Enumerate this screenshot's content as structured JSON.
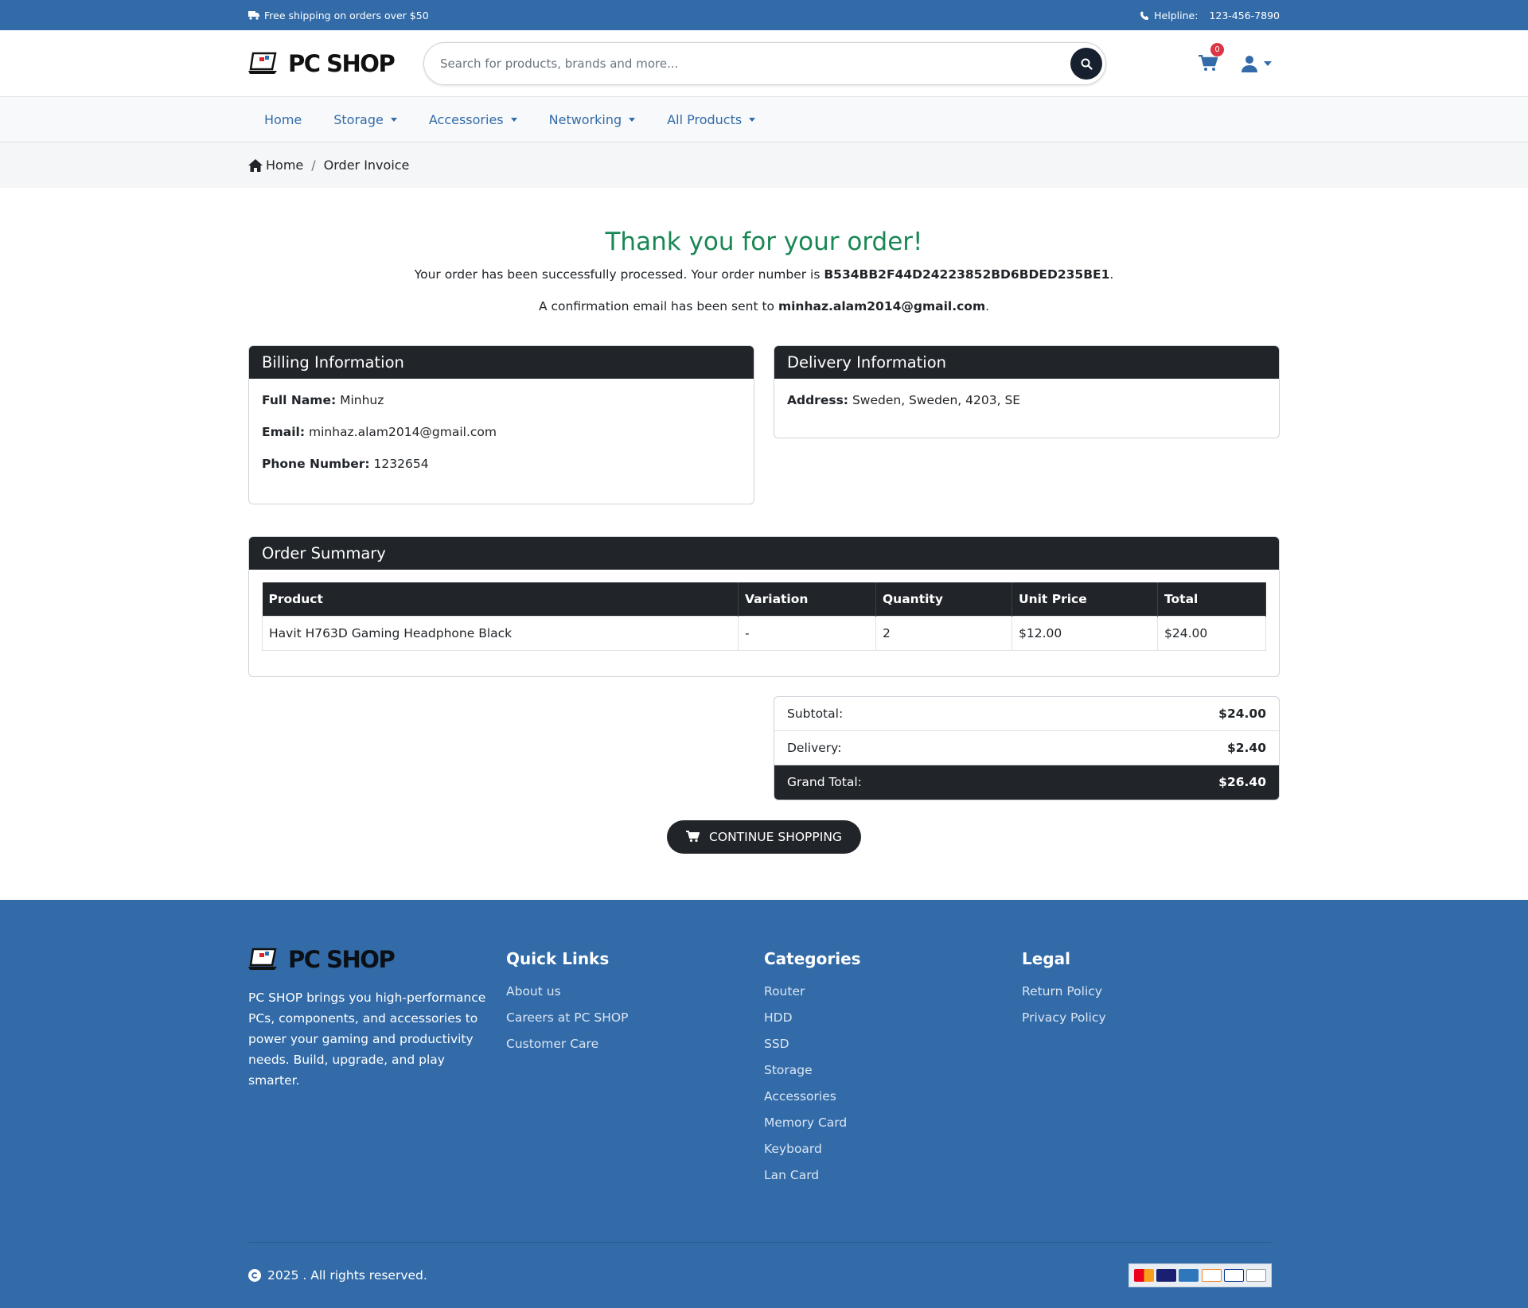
{
  "topbar": {
    "shipping_text": "Free shipping on orders over $50",
    "helpline_label": "Helpline:",
    "helpline_number": "123-456-7890"
  },
  "header": {
    "logo_text": "PC SHOP",
    "search_placeholder": "Search for products, brands and more...",
    "cart_count": "0"
  },
  "nav": {
    "items": [
      {
        "label": "Home",
        "dropdown": false
      },
      {
        "label": "Storage",
        "dropdown": true
      },
      {
        "label": "Accessories",
        "dropdown": true
      },
      {
        "label": "Networking",
        "dropdown": true
      },
      {
        "label": "All Products",
        "dropdown": true
      }
    ]
  },
  "breadcrumb": {
    "home": "Home",
    "separator": "/",
    "current": "Order Invoice"
  },
  "confirmation": {
    "title": "Thank you for your order!",
    "order_prefix": "Your order has been successfully processed. Your order number is ",
    "order_number": "B534BB2F44D24223852BD6BDED235BE1",
    "email_prefix": "A confirmation email has been sent to ",
    "email": "minhaz.alam2014@gmail.com",
    "period": "."
  },
  "billing": {
    "title": "Billing Information",
    "full_name_label": "Full Name:",
    "full_name": "Minhuz",
    "email_label": "Email:",
    "email": "minhaz.alam2014@gmail.com",
    "phone_label": "Phone Number:",
    "phone": "1232654"
  },
  "delivery": {
    "title": "Delivery Information",
    "address_label": "Address:",
    "address": "Sweden, Sweden, 4203, SE"
  },
  "order_summary": {
    "title": "Order Summary",
    "columns": [
      "Product",
      "Variation",
      "Quantity",
      "Unit Price",
      "Total"
    ],
    "rows": [
      [
        "Havit H763D Gaming Headphone Black",
        "-",
        "2",
        "$12.00",
        "$24.00"
      ]
    ]
  },
  "totals": {
    "subtotal_label": "Subtotal:",
    "subtotal": "$24.00",
    "delivery_label": "Delivery:",
    "delivery": "$2.40",
    "grand_label": "Grand Total:",
    "grand": "$26.40"
  },
  "continue_label": "CONTINUE SHOPPING",
  "footer": {
    "logo_text": "PC SHOP",
    "about": "PC SHOP brings you high-performance PCs, components, and accessories to power your gaming and productivity needs. Build, upgrade, and play smarter.",
    "quick_links": {
      "title": "Quick Links",
      "links": [
        "About us",
        "Careers at PC SHOP",
        "Customer Care"
      ]
    },
    "categories": {
      "title": "Categories",
      "links": [
        "Router",
        "HDD",
        "SSD",
        "Storage",
        "Accessories",
        "Memory Card",
        "Keyboard",
        "Lan Card"
      ]
    },
    "legal": {
      "title": "Legal",
      "links": [
        "Return Policy",
        "Privacy Policy"
      ]
    },
    "copyright": "2025 . All rights reserved."
  },
  "colors": {
    "brand_blue": "#326ba8",
    "dark": "#212529",
    "success_green": "#198754",
    "badge_red": "#dc3545"
  }
}
